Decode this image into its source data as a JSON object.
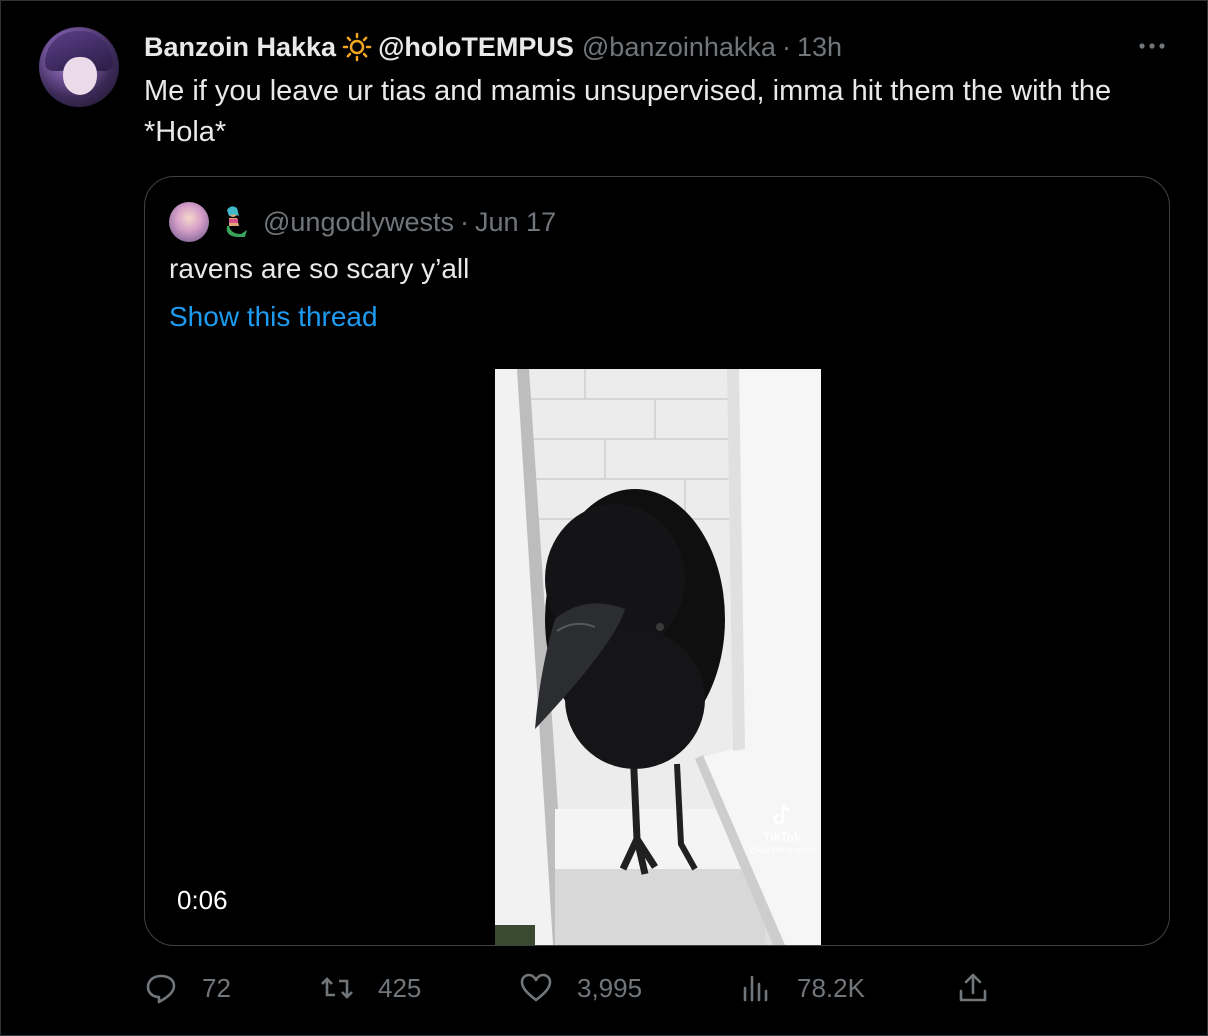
{
  "tweet": {
    "display_name": "Banzoin Hakka",
    "name_suffix": "@holoTEMPUS",
    "handle": "@banzoinhakka",
    "separator": "·",
    "time": "13h",
    "text": "Me if you leave ur tias and mamis unsupervised, imma hit them the with the *Hola*"
  },
  "quote": {
    "handle": "@ungodlywests",
    "separator": "·",
    "date": "Jun 17",
    "text": "ravens are so scary y’all",
    "show_thread": "Show this thread",
    "video": {
      "duration": "0:06",
      "watermark_brand": "TikTok",
      "watermark_user": "@vantatheraven"
    }
  },
  "actions": {
    "replies": "72",
    "retweets": "425",
    "likes": "3,995",
    "views": "78.2K"
  },
  "icons": {
    "verified_emoji": "sun-icon",
    "quote_emoji": "mermaid-icon",
    "reply": "reply-icon",
    "retweet": "retweet-icon",
    "like": "heart-icon",
    "views": "views-icon",
    "share": "share-icon",
    "more": "more-icon"
  },
  "colors": {
    "background": "#000000",
    "text": "#e7e9ea",
    "muted": "#71767b",
    "link": "#1d9bf0",
    "border": "#3e4144",
    "sun": "#f5a623"
  }
}
